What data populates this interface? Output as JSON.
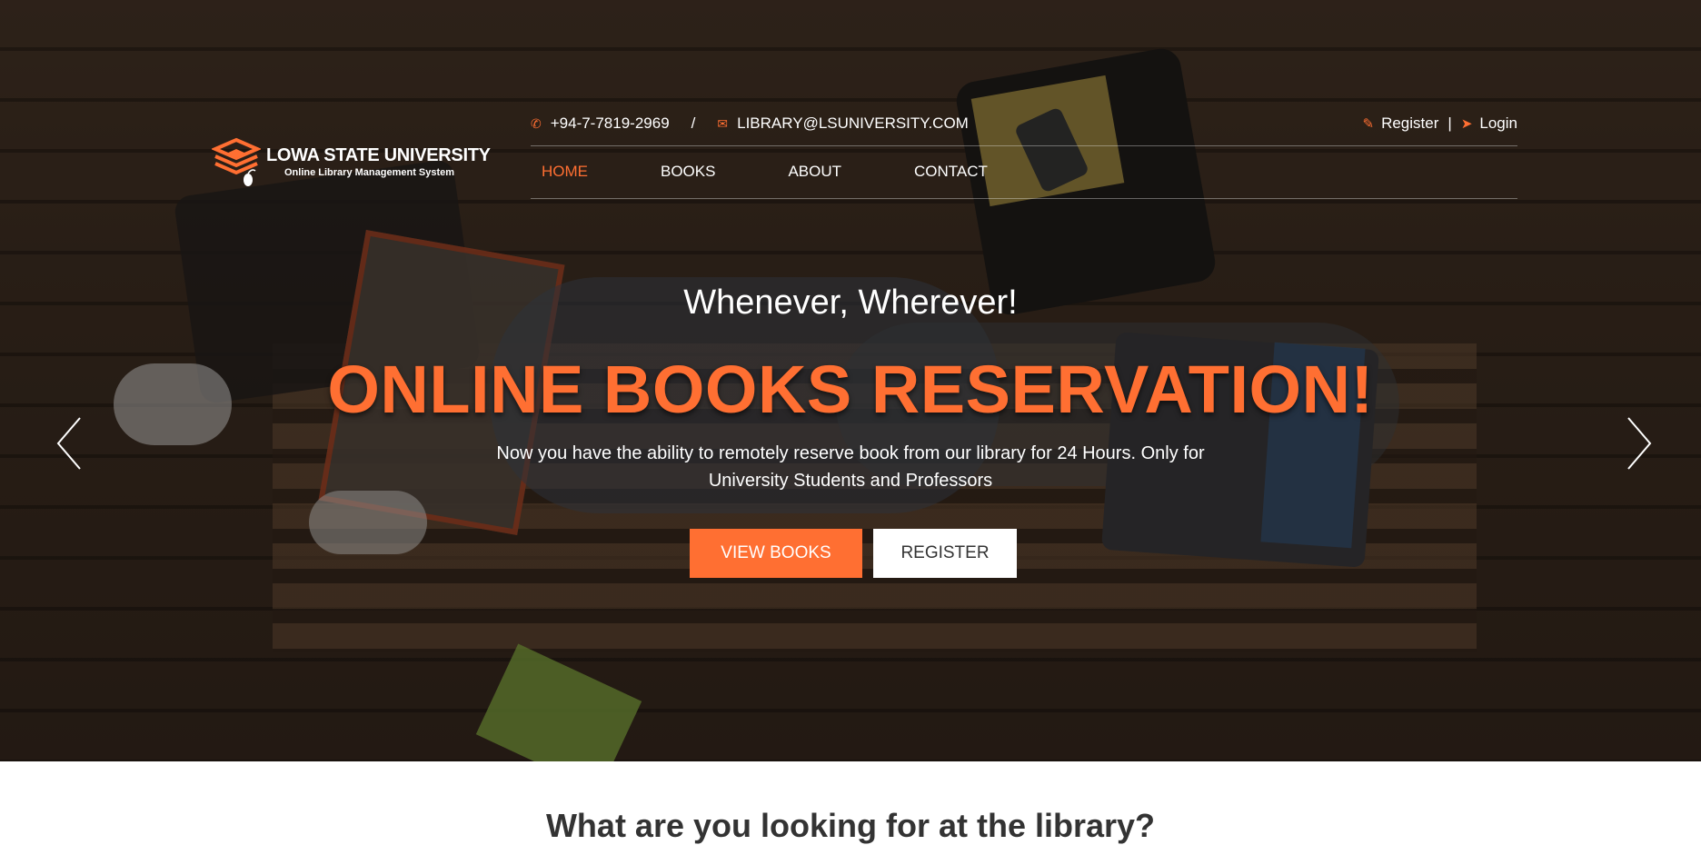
{
  "brand": {
    "title": "LOWA STATE UNIVERSITY",
    "subtitle": "Online Library Management System"
  },
  "topbar": {
    "phone": "+94-7-7819-2969",
    "separator": "/",
    "email": "LIBRARY@LSUNIVERSITY.COM",
    "register": "Register",
    "divider": "|",
    "login": "Login"
  },
  "nav": {
    "items": [
      "HOME",
      "BOOKS",
      "ABOUT",
      "CONTACT"
    ],
    "active": "HOME"
  },
  "hero": {
    "tagline": "Whenever, Wherever!",
    "headline": "ONLINE BOOKS RESERVATION!",
    "description": "Now you have the ability to remotely reserve book from our library for 24 Hours. Only for University Students and Professors",
    "primary_button": "VIEW BOOKS",
    "secondary_button": "REGISTER"
  },
  "next_section": {
    "title": "What are you looking for at the library?"
  },
  "colors": {
    "accent": "#ff6f32",
    "text_light": "#ffffff",
    "text_dark": "#333333"
  },
  "icons": {
    "phone": "phone-icon",
    "email": "envelope-icon",
    "register": "edit-icon",
    "login": "sign-in-icon",
    "prev": "chevron-left-icon",
    "next": "chevron-right-icon"
  }
}
